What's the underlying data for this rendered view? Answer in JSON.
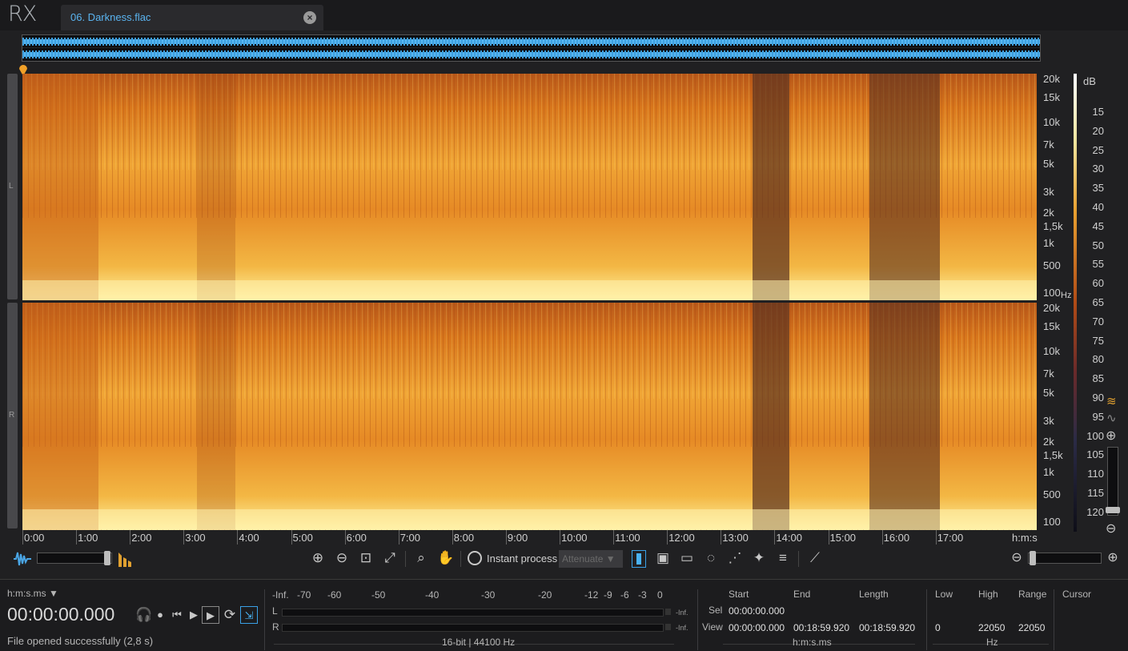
{
  "app": {
    "logo": "RX"
  },
  "file_tab": {
    "title": "06. Darkness.flac",
    "close_icon": "close-icon"
  },
  "spectrogram": {
    "channels": [
      "L",
      "R"
    ],
    "freq_labels": [
      "20k",
      "15k",
      "10k",
      "7k",
      "5k",
      "3k",
      "2k",
      "1,5k",
      "1k",
      "500",
      "100"
    ],
    "freq_unit": "Hz",
    "db_unit": "dB",
    "db_scale": [
      "15",
      "20",
      "25",
      "30",
      "35",
      "40",
      "45",
      "50",
      "55",
      "60",
      "65",
      "70",
      "75",
      "80",
      "85",
      "90",
      "95",
      "100",
      "105",
      "110",
      "115",
      "120"
    ],
    "time_labels": [
      "0:00",
      "1:00",
      "2:00",
      "3:00",
      "4:00",
      "5:00",
      "6:00",
      "7:00",
      "8:00",
      "9:00",
      "10:00",
      "11:00",
      "12:00",
      "13:00",
      "14:00",
      "15:00",
      "16:00",
      "17:00"
    ],
    "time_unit": "h:m:s",
    "colors": {
      "hot": "#f5c740",
      "mid": "#d9791a",
      "dark": "#6e3514"
    }
  },
  "toolbar": {
    "instant_process_label": "Instant process",
    "attenuate_select": "Attenuate ▼"
  },
  "transport": {
    "time_format": "h:m:s.ms ▼",
    "time_value": "00:00:00.000",
    "status": "File opened successfully (2,8 s)"
  },
  "meter": {
    "scale": [
      "-Inf.",
      "-70",
      "-60",
      "-50",
      "-40",
      "-30",
      "-20",
      "-12",
      "-9",
      "-6",
      "-3",
      "0"
    ],
    "channel_l": "L",
    "channel_r": "R",
    "peak_l": "-Inf.",
    "peak_r": "-Inf.",
    "format": "16-bit | 44100 Hz"
  },
  "selection": {
    "headers": {
      "start": "Start",
      "end": "End",
      "length": "Length"
    },
    "sel_label": "Sel",
    "sel_start": "00:00:00.000",
    "view_label": "View",
    "view_start": "00:00:00.000",
    "view_end": "00:18:59.920",
    "view_length": "00:18:59.920",
    "unit": "h:m:s.ms"
  },
  "frequency": {
    "headers": {
      "low": "Low",
      "high": "High",
      "range": "Range"
    },
    "low": "0",
    "high": "22050",
    "range": "22050",
    "unit": "Hz"
  },
  "cursor": {
    "label": "Cursor"
  }
}
